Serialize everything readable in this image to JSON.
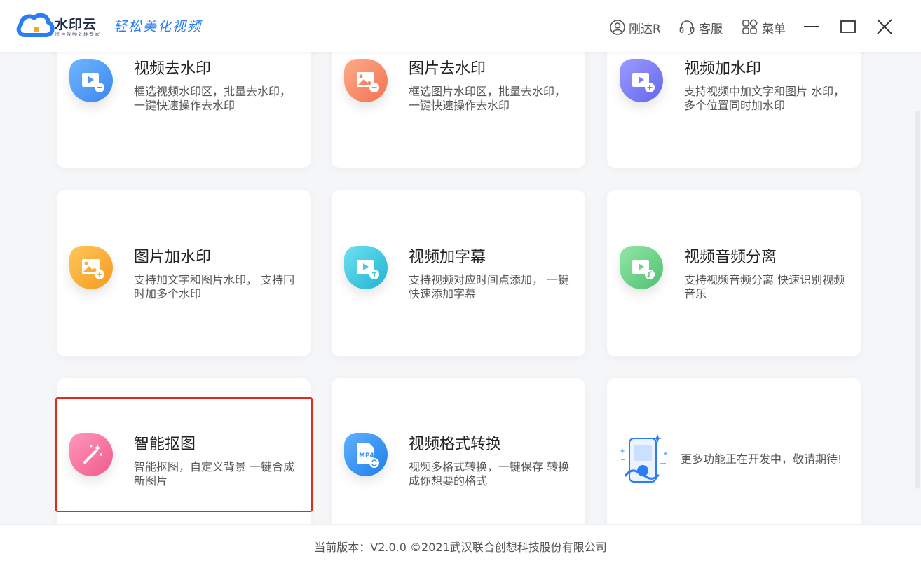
{
  "header": {
    "brand": "水印云",
    "brand_sub": "图片视频处理专家",
    "slogan": "轻松美化视频",
    "user_label": "刚达R",
    "service_label": "客服",
    "menu_label": "菜单"
  },
  "cards": [
    {
      "title": "视频去水印",
      "desc": "框选视频水印区，批量去水印， 一键快速操作去水印",
      "icon": "video-remove-icon",
      "color": "#4b98f5"
    },
    {
      "title": "图片去水印",
      "desc": "框选图片水印区，批量去水印， 一键快速操作去水印",
      "icon": "image-remove-icon",
      "color": "#f58a68"
    },
    {
      "title": "视频加水印",
      "desc": "支持视频中加文字和图片 水印，多个位置同时加水印",
      "icon": "video-add-icon",
      "color": "#7b7ef5"
    },
    {
      "title": "图片加水印",
      "desc": "支持加文字和图片水印， 支持同时加多个水印",
      "icon": "image-add-icon",
      "color": "#f8ad3b"
    },
    {
      "title": "视频加字幕",
      "desc": "支持视频对应时间点添加， 一键快速添加字幕",
      "icon": "video-subtitle-icon",
      "color": "#3fcbe0"
    },
    {
      "title": "视频音频分离",
      "desc": "支持视频音频分离 快速识别视频音乐",
      "icon": "video-audio-icon",
      "color": "#6ed28c"
    },
    {
      "title": "智能抠图",
      "desc": "智能抠图，自定义背景 一键合成新图片",
      "icon": "magic-wand-icon",
      "color": "#f26a9a"
    },
    {
      "title": "视频格式转换",
      "desc": "视频多格式转换，一键保存 转换成你想要的格式",
      "icon": "mp4-convert-icon",
      "color": "#2f8ff2",
      "badge": "MP4"
    }
  ],
  "coming_soon": "更多功能正在开发中，敬请期待!",
  "footer": "当前版本：V2.0.0 ©2021武汉联合创想科技股份有限公司",
  "selected_card": "智能抠图"
}
